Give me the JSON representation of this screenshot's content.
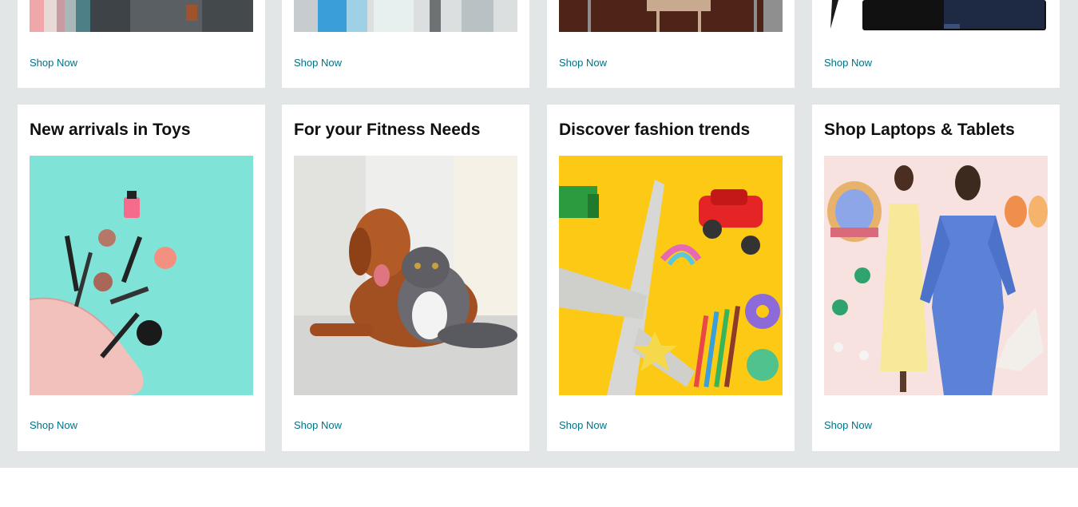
{
  "top_row": [
    {
      "shop_label": "Shop Now",
      "image_icon": "headphones-products-image"
    },
    {
      "shop_label": "Shop Now",
      "image_icon": "appliance-products-image"
    },
    {
      "shop_label": "Shop Now",
      "image_icon": "furniture-products-image"
    },
    {
      "shop_label": "Shop Now",
      "image_icon": "tablet-products-image"
    }
  ],
  "bottom_row": [
    {
      "title": "New arrivals in Toys",
      "shop_label": "Shop Now",
      "image_icon": "cosmetics-image"
    },
    {
      "title": "For your Fitness Needs",
      "shop_label": "Shop Now",
      "image_icon": "dog-and-cat-image"
    },
    {
      "title": "Discover fashion trends",
      "shop_label": "Shop Now",
      "image_icon": "toys-image"
    },
    {
      "title": "Shop Laptops & Tablets",
      "shop_label": "Shop Now",
      "image_icon": "fashion-models-image"
    }
  ],
  "colors": {
    "link": "#007185",
    "band": "#e3e6e6",
    "title": "#0f1111"
  }
}
